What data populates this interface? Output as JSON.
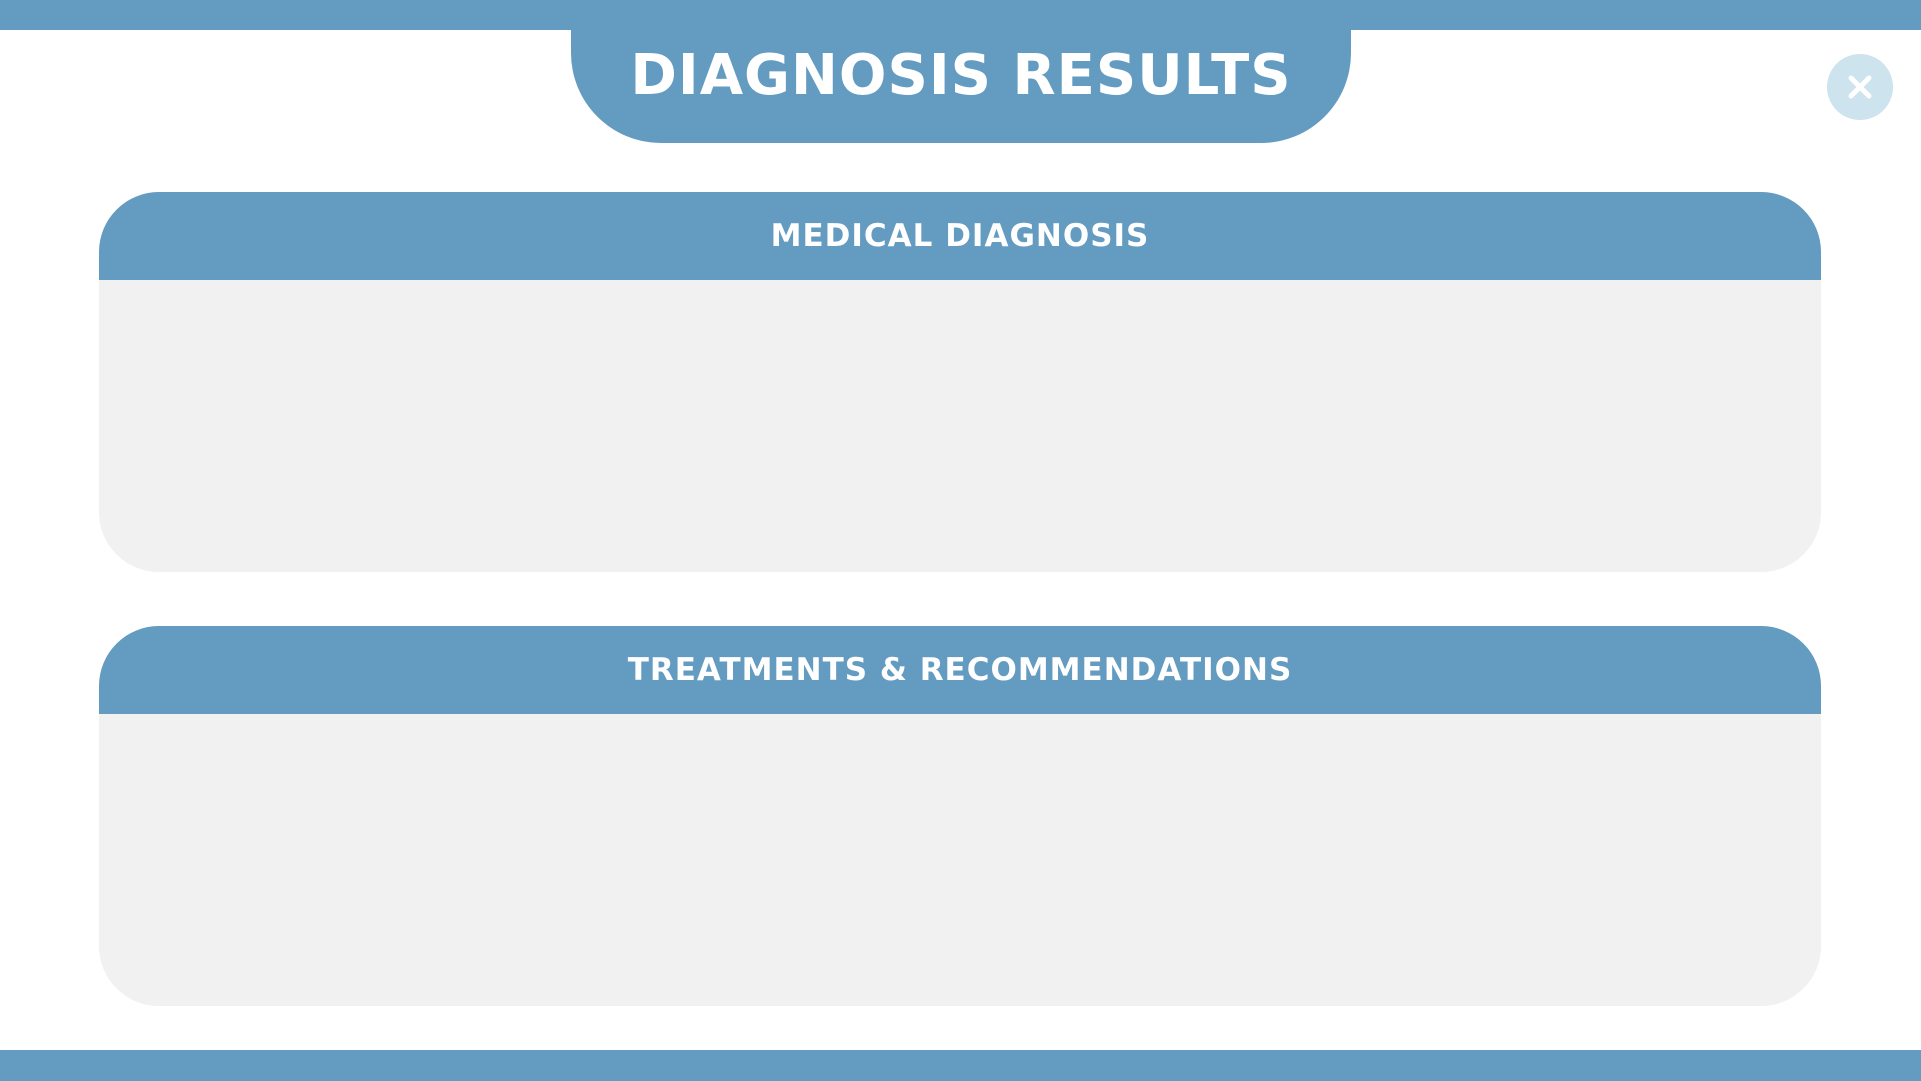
{
  "window": {
    "title": "DIAGNOSIS RESULTS"
  },
  "close_button": {
    "icon": "close-icon"
  },
  "sections": [
    {
      "heading": "MEDICAL DIAGNOSIS",
      "content": ""
    },
    {
      "heading": "TREATMENTS & RECOMMENDATIONS",
      "content": ""
    }
  ],
  "colors": {
    "accent": "#639bc1",
    "panel_body": "#f0f1f0",
    "close_button_bg": "#cde3ed",
    "background": "#ffffff"
  }
}
